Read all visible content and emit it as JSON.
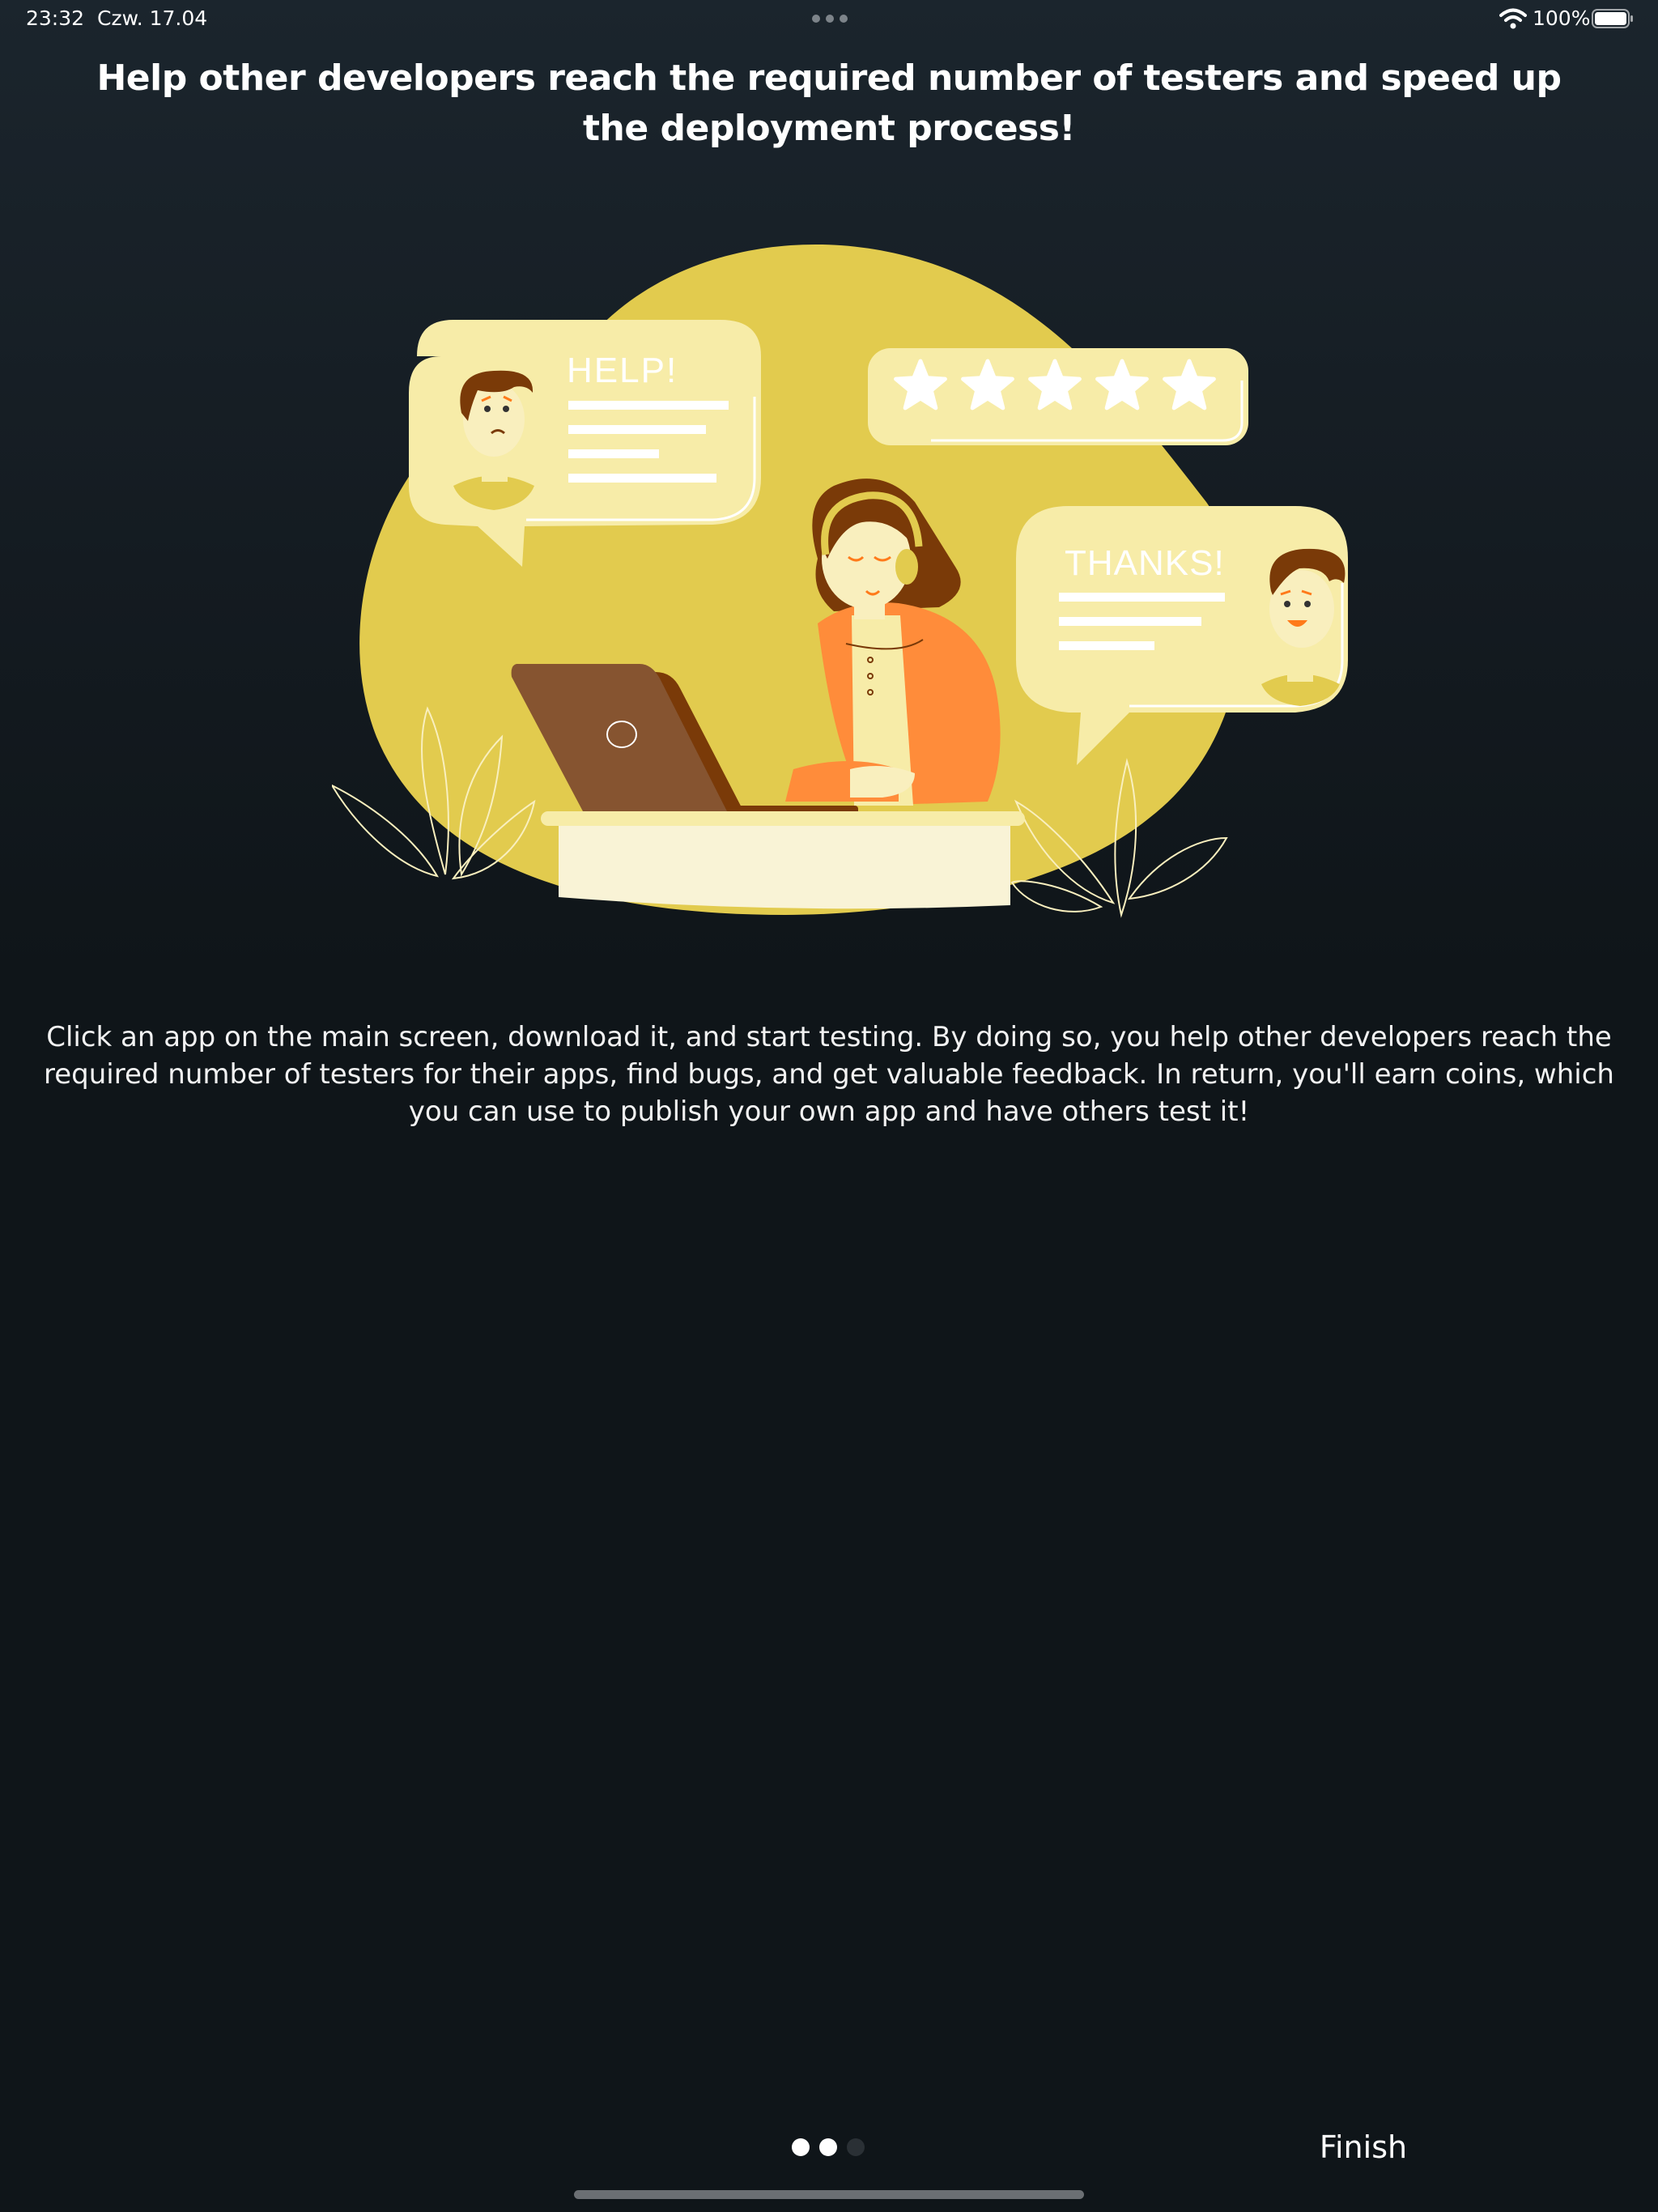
{
  "status_bar": {
    "time": "23:32",
    "date": "Czw. 17.04",
    "battery_percent": "100%",
    "battery_level": 1.0,
    "wifi_icon": "wifi-icon",
    "battery_icon": "battery-icon"
  },
  "onboarding": {
    "headline": "Help other developers reach the required number of testers and speed up the deployment process!",
    "illustration": {
      "help_bubble_text": "HELP!",
      "thanks_bubble_text": "THANKS!",
      "rating_stars": 5
    },
    "body": "Click an app on the main screen, download it, and start testing. By doing so, you help other developers reach the required number of testers for their apps, find bugs, and get valuable feedback. In return, you'll earn coins, which you can use to publish your own app and have others test it!"
  },
  "footer": {
    "page_count": 3,
    "current_page": 2,
    "finish_label": "Finish"
  },
  "colors": {
    "background": "#0f1519",
    "accent_yellow": "#e2cb4e",
    "bubble_light": "#f7eca8",
    "orange": "#ff8c3a",
    "brown": "#7a3a08",
    "dot_active": "#ffffff",
    "dot_inactive": "#2a3035"
  }
}
